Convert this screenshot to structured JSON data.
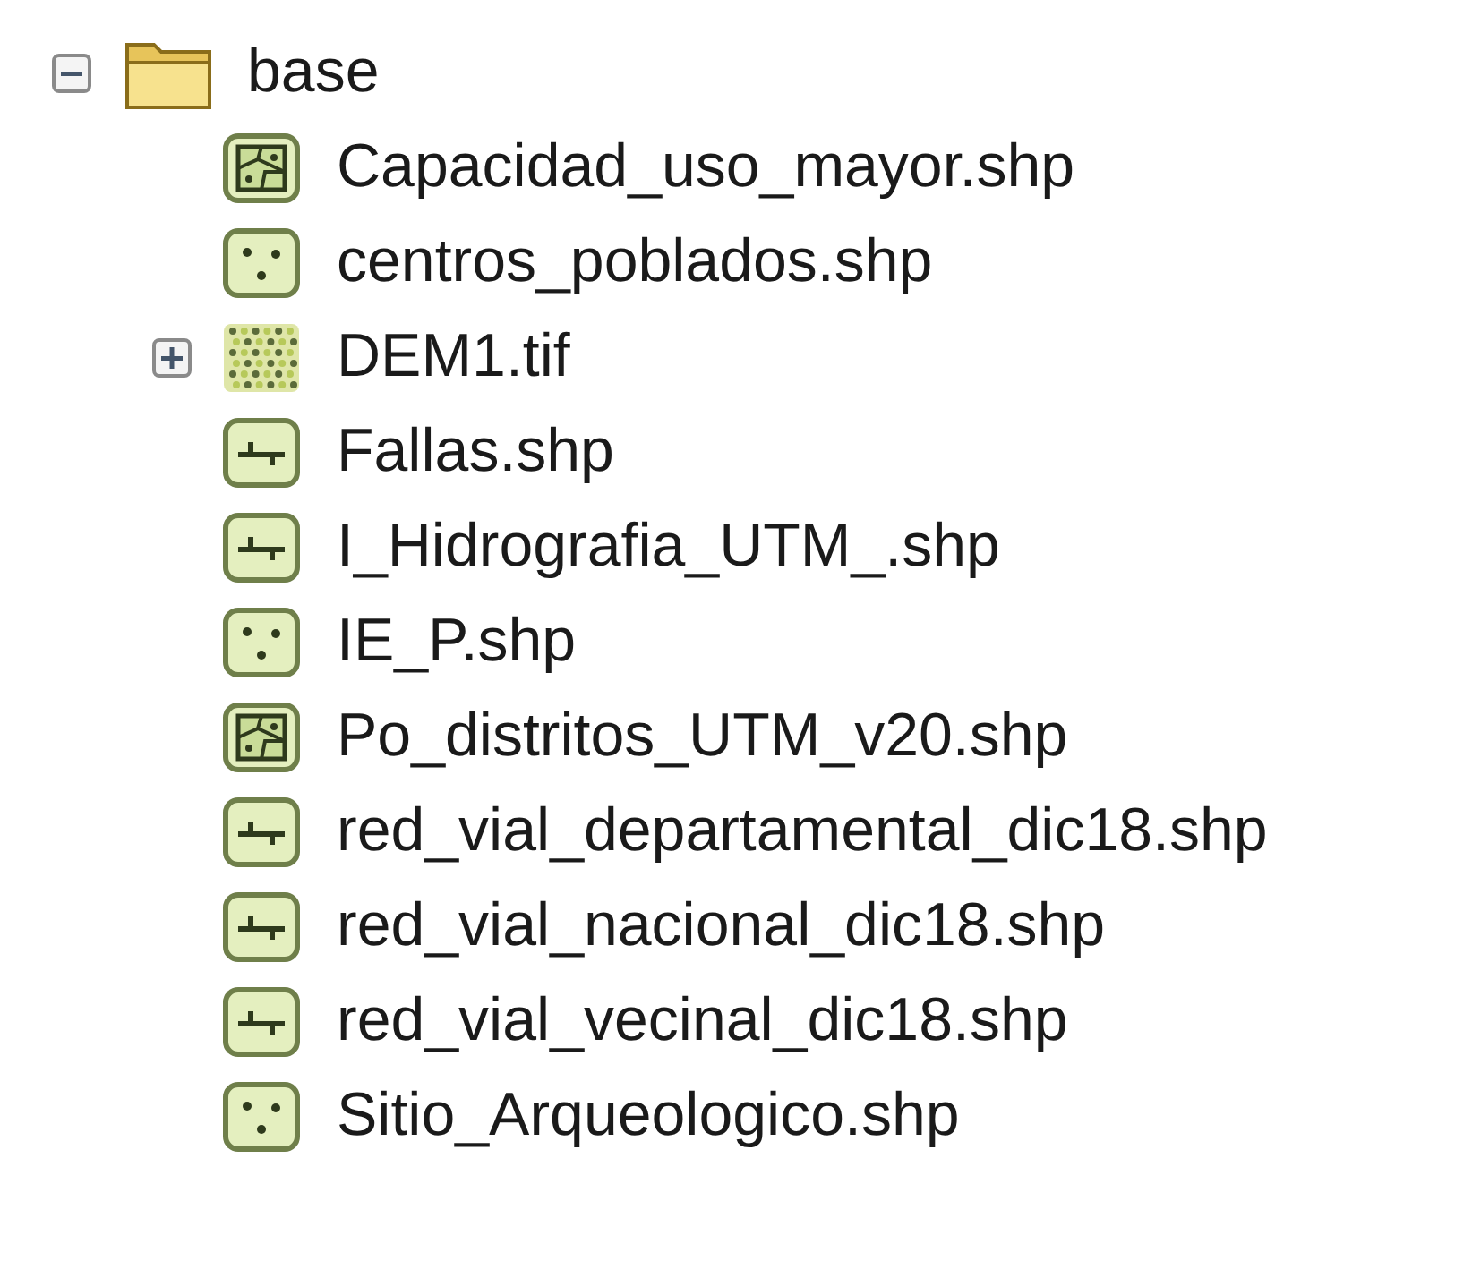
{
  "tree": {
    "name": "base",
    "expanded": true,
    "children": [
      {
        "name": "Capacidad_uso_mayor.shp",
        "kind": "polygon"
      },
      {
        "name": "centros_poblados.shp",
        "kind": "point"
      },
      {
        "name": "DEM1.tif",
        "kind": "raster",
        "expanded": false
      },
      {
        "name": "Fallas.shp",
        "kind": "line"
      },
      {
        "name": "I_Hidrografia_UTM_.shp",
        "kind": "line"
      },
      {
        "name": "IE_P.shp",
        "kind": "point"
      },
      {
        "name": "Po_distritos_UTM_v20.shp",
        "kind": "polygon"
      },
      {
        "name": "red_vial_departamental_dic18.shp",
        "kind": "line"
      },
      {
        "name": "red_vial_nacional_dic18.shp",
        "kind": "line"
      },
      {
        "name": "red_vial_vecinal_dic18.shp",
        "kind": "line"
      },
      {
        "name": "Sitio_Arqueologico.shp",
        "kind": "point"
      }
    ]
  }
}
